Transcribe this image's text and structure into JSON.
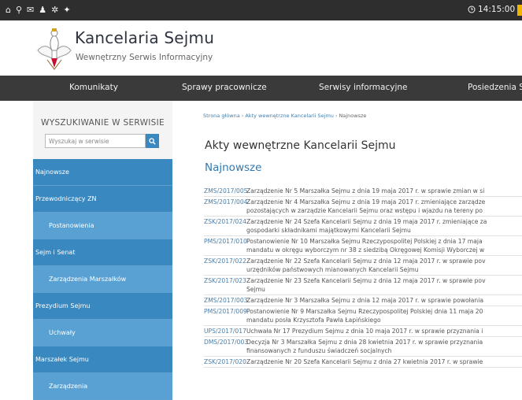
{
  "topbar": {
    "icons": [
      "home-icon",
      "sitemap-icon",
      "mail-icon",
      "user-icon",
      "settings-icon",
      "accessibility-icon"
    ],
    "time": "14:15:00",
    "accent_color": "#f0b400"
  },
  "header": {
    "title": "Kancelaria Sejmu",
    "subtitle": "Wewnętrzny Serwis Informacyjny"
  },
  "nav": {
    "items": [
      {
        "label": "Komunikaty"
      },
      {
        "label": "Sprawy pracownicze"
      },
      {
        "label": "Serwisy informacyjne"
      },
      {
        "label": "Posiedzenia Se"
      }
    ]
  },
  "search": {
    "title": "WYSZUKIWANIE W SERWISIE",
    "placeholder": "Wyszukaj w serwisie"
  },
  "sidebar": {
    "items": [
      {
        "label": "Najnowsze",
        "level": "parent"
      },
      {
        "label": "Przewodniczący ZN",
        "level": "parent"
      },
      {
        "label": "Postanowienia",
        "level": "child"
      },
      {
        "label": "Sejm i Senat",
        "level": "parent"
      },
      {
        "label": "Zarządzenia Marszałków",
        "level": "child"
      },
      {
        "label": "Prezydium Sejmu",
        "level": "parent"
      },
      {
        "label": "Uchwały",
        "level": "child"
      },
      {
        "label": "Marszałek Sejmu",
        "level": "parent"
      },
      {
        "label": "Zarządzenia",
        "level": "child"
      }
    ]
  },
  "breadcrumb": {
    "home": "Strona główna",
    "section": "Akty wewnętrzne Kancelarii Sejmu",
    "current": "Najnowsze",
    "separator": "›"
  },
  "main": {
    "page_title": "Akty wewnętrzne Kancelarii Sejmu",
    "section_title": "Najnowsze",
    "documents": [
      {
        "code": "ZMS/2017/005",
        "lines": [
          "Zarządzenie Nr 5 Marszałka Sejmu z dnia 19 maja 2017 r. w sprawie zmian w si"
        ]
      },
      {
        "code": "ZMS/2017/004",
        "lines": [
          "Zarządzenie Nr 4 Marszałka Sejmu z dnia 19 maja 2017 r. zmieniające zarządze",
          "pozostających w zarządzie Kancelarii Sejmu oraz wstępu i wjazdu na tereny po"
        ]
      },
      {
        "code": "ZSK/2017/024",
        "lines": [
          "Zarządzenie Nr 24 Szefa Kancelarii Sejmu z dnia 19 maja 2017 r. zmieniające za",
          "gospodarki składnikami majątkowymi Kancelarii Sejmu"
        ]
      },
      {
        "code": "PMS/2017/010",
        "lines": [
          "Postanowienie Nr 10 Marszałka Sejmu Rzeczypospolitej Polskiej z dnia 17 maja",
          "mandatu w okręgu wyborczym nr 38 z siedzibą Okręgowej Komisji Wyborczej w"
        ]
      },
      {
        "code": "ZSK/2017/022",
        "lines": [
          "Zarządzenie Nr 22 Szefa Kancelarii Sejmu z dnia 12 maja 2017 r. w sprawie pov",
          "urzędników państwowych mianowanych Kancelarii Sejmu"
        ]
      },
      {
        "code": "ZSK/2017/023",
        "lines": [
          "Zarządzenie Nr 23 Szefa Kancelarii Sejmu z dnia 12 maja 2017 r. w sprawie pov",
          "Sejmu"
        ]
      },
      {
        "code": "ZMS/2017/003",
        "lines": [
          "Zarządzenie Nr 3 Marszałka Sejmu z dnia 12 maja 2017 r. w sprawie powołania"
        ]
      },
      {
        "code": "PMS/2017/009",
        "lines": [
          "Postanowienie Nr 9 Marszałka Sejmu Rzeczypospolitej Polskiej dnia 11 maja 20",
          "mandatu posła Krzysztofa Pawła Łapińskiego"
        ]
      },
      {
        "code": "UPS/2017/017",
        "lines": [
          "Uchwała Nr 17 Prezydium Sejmu z dnia 10 maja 2017 r. w sprawie przyznania i"
        ]
      },
      {
        "code": "DMS/2017/003",
        "lines": [
          "Decyzja Nr 3 Marszałka Sejmu z dnia 28 kwietnia 2017 r. w sprawie przyznania",
          "finansowanych z funduszu świadczeń socjalnych"
        ]
      },
      {
        "code": "ZSK/2017/020",
        "lines": [
          "Zarządzenie Nr 20 Szefa Kancelarii Sejmu z dnia 27 kwietnia 2017 r. w sprawie"
        ]
      }
    ]
  }
}
